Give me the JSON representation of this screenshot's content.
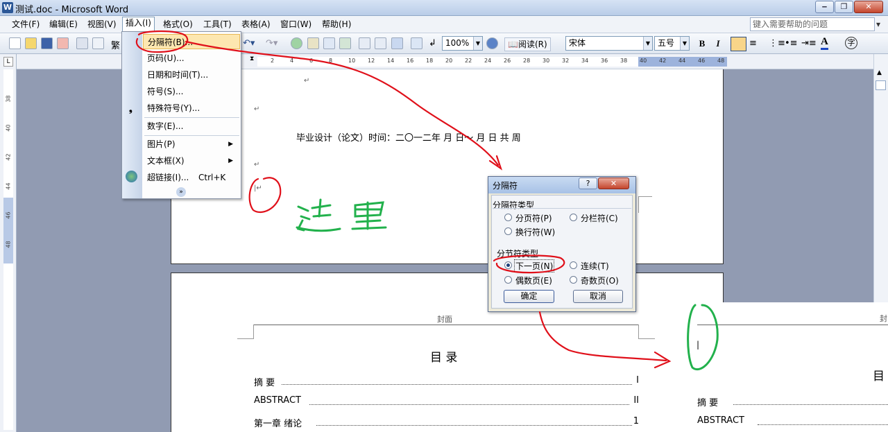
{
  "window": {
    "title": "测试.doc - Microsoft Word",
    "app_icon": "W"
  },
  "menubar": {
    "items": [
      "文件(F)",
      "编辑(E)",
      "视图(V)",
      "插入(I)",
      "格式(O)",
      "工具(T)",
      "表格(A)",
      "窗口(W)",
      "帮助(H)"
    ],
    "help_placeholder": "键入需要帮助的问题"
  },
  "toolbar": {
    "zoom": "100%",
    "read_label": "阅读(R)",
    "font": "宋体",
    "font_size": "五号",
    "bold": "B",
    "italic": "I",
    "clipped_label": "繁"
  },
  "ruler": {
    "h_ticks": [
      "2",
      "4",
      "6",
      "8",
      "10",
      "12",
      "14",
      "16",
      "18",
      "20",
      "22",
      "24",
      "26",
      "28",
      "30",
      "32",
      "34",
      "36",
      "38",
      "40",
      "42",
      "44",
      "46",
      "48"
    ],
    "v_ticks": [
      "38",
      "40",
      "42",
      "44",
      "46",
      "48"
    ]
  },
  "insert_menu": {
    "items": [
      {
        "label": "分隔符(B)...",
        "highlighted": true
      },
      {
        "label": "页码(U)..."
      },
      {
        "label": "日期和时间(T)..."
      },
      {
        "label": "符号(S)..."
      },
      {
        "label": "特殊符号(Y)..."
      },
      {
        "label": "数字(E)..."
      },
      {
        "label": "图片(P)",
        "submenu": true
      },
      {
        "label": "文本框(X)",
        "submenu": true
      },
      {
        "label": "超链接(I)...",
        "shortcut": "Ctrl+K"
      }
    ]
  },
  "page1": {
    "line": "毕业设计（论文）时间：二〇一二年  月   日～   月   日  共      周",
    "annotation": "这里"
  },
  "page2": {
    "header": "封面",
    "toc_title": "目  录",
    "toc": [
      {
        "title": "摘    要",
        "page": "I"
      },
      {
        "title": "ABSTRACT",
        "page": "II"
      },
      {
        "title": "第一章   绪论",
        "page": "1"
      }
    ]
  },
  "dialog": {
    "title": "分隔符",
    "group1": "分隔符类型",
    "opt_page": "分页符(P)",
    "opt_column": "分栏符(C)",
    "opt_wrap": "换行符(W)",
    "group2": "分节符类型",
    "opt_next": "下一页(N)",
    "opt_cont": "连续(T)",
    "opt_even": "偶数页(E)",
    "opt_odd": "奇数页(O)",
    "ok": "确定",
    "cancel": "取消"
  },
  "right_page": {
    "header": "封",
    "title": "目",
    "toc": [
      "摘    要",
      "ABSTRACT"
    ]
  },
  "colors": {
    "annotation_red": "#e0101a",
    "annotation_green": "#22b14c"
  }
}
